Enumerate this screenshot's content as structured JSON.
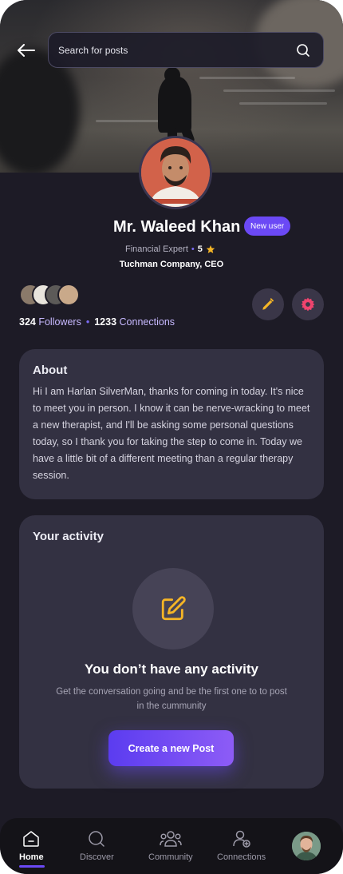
{
  "search": {
    "placeholder": "Search for posts"
  },
  "profile": {
    "name": "Mr. Waleed Khan",
    "badge": "New user",
    "role": "Financial Expert",
    "rating": "5",
    "company": "Tuchman Company, CEO"
  },
  "stats": {
    "followers_count": "324",
    "followers_label": "Followers",
    "connections_count": "1233",
    "connections_label": "Connections"
  },
  "about": {
    "title": "About",
    "text": "Hi I am Harlan SilverMan, thanks for coming in today. It's nice to meet you in person. I know it can be nerve-wracking to meet a new therapist, and I'll be asking some personal questions today, so I thank you for taking the step to come in. Today we have a little bit of a different meeting than a regular therapy session."
  },
  "activity": {
    "title": "Your activity",
    "empty_title": "You don’t have any activity",
    "empty_sub": "Get the conversation going and be the first one to to post in the cummunity",
    "button": "Create a new Post"
  },
  "nav": {
    "items": [
      {
        "label": "Home",
        "icon": "home-icon"
      },
      {
        "label": "Discover",
        "icon": "search-icon"
      },
      {
        "label": "Community",
        "icon": "community-icon"
      },
      {
        "label": "Connections",
        "icon": "add-user-icon"
      }
    ]
  },
  "colors": {
    "background": "#1d1b26",
    "card": "#333142",
    "accent": "#6b49f5",
    "edit_icon": "#f5b526",
    "settings_icon": "#f0446e",
    "star": "#f5b526"
  }
}
